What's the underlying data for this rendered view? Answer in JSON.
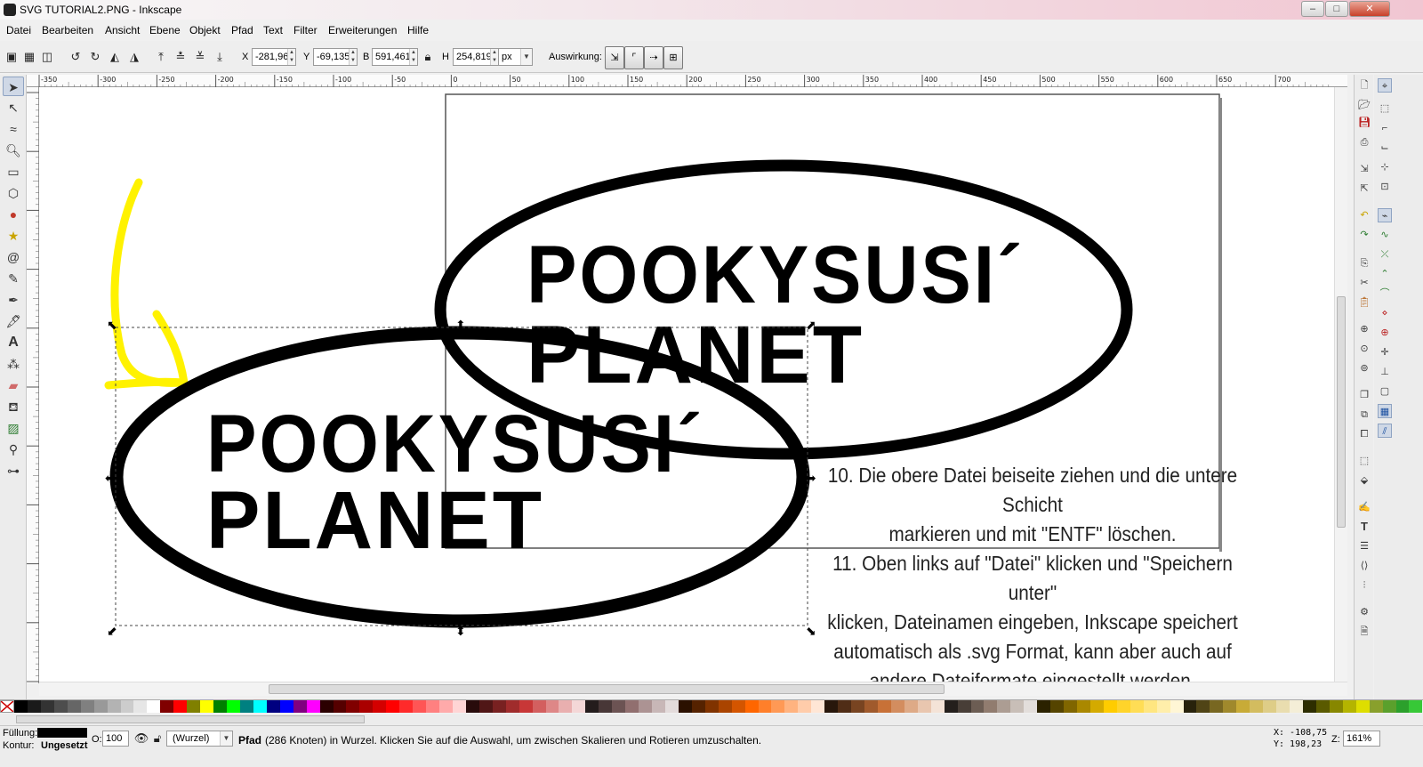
{
  "window": {
    "title": "SVG TUTORIAL2.PNG - Inkscape",
    "minimize_label": "–",
    "maximize_label": "□",
    "close_label": "✕"
  },
  "menu": [
    "Datei",
    "Bearbeiten",
    "Ansicht",
    "Ebene",
    "Objekt",
    "Pfad",
    "Text",
    "Filter",
    "Erweiterungen",
    "Hilfe"
  ],
  "toolbar": {
    "x_label": "X",
    "x_value": "-281,964",
    "y_label": "Y",
    "y_value": "-69,135",
    "w_label": "B",
    "w_value": "591,461",
    "h_label": "H",
    "h_value": "254,819",
    "unit": "px",
    "affect_label": "Auswirkung:"
  },
  "ruler": {
    "labels": [
      "-350",
      "-300",
      "-250",
      "-200",
      "-150",
      "-100",
      "-50",
      "0",
      "50",
      "100",
      "150",
      "200",
      "250",
      "300",
      "350",
      "400",
      "450",
      "500",
      "550",
      "600",
      "650",
      "700"
    ]
  },
  "canvas": {
    "logo_text_line1": "POOKYSUSI´",
    "logo_text_line2": "PLANET",
    "instructions": [
      "10. Die obere Datei beiseite ziehen und die untere Schicht",
      "markieren und mit \"ENTF\" löschen.",
      "11. Oben links auf \"Datei\" klicken und \"Speichern unter\"",
      "klicken, Dateinamen eingeben, Inkscape speichert",
      "automatisch als .svg Format, kann aber auch auf",
      "andere Dateiformate eingestellt werden."
    ],
    "arrow_color": "#fff200"
  },
  "palette": [
    "#000000",
    "#1a1a1a",
    "#333333",
    "#4d4d4d",
    "#666666",
    "#808080",
    "#999999",
    "#b3b3b3",
    "#cccccc",
    "#e6e6e6",
    "#ffffff",
    "#800000",
    "#ff0000",
    "#808000",
    "#ffff00",
    "#008000",
    "#00ff00",
    "#008080",
    "#00ffff",
    "#000080",
    "#0000ff",
    "#800080",
    "#ff00ff",
    "#2b0000",
    "#550000",
    "#800000",
    "#aa0000",
    "#d40000",
    "#ff0000",
    "#ff2a2a",
    "#ff5555",
    "#ff8080",
    "#ffaaaa",
    "#ffd5d5",
    "#280b0b",
    "#501616",
    "#782121",
    "#a02c2c",
    "#c83737",
    "#d35f5f",
    "#de8787",
    "#e9afaf",
    "#f4d7d7",
    "#241c1c",
    "#483737",
    "#6c5353",
    "#916f6f",
    "#ac9393",
    "#c8b7b7",
    "#e3dbdb",
    "#2b1100",
    "#552200",
    "#803300",
    "#aa4400",
    "#d45500",
    "#ff6600",
    "#ff7f2a",
    "#ff9955",
    "#ffb380",
    "#ffccaa",
    "#ffe6d5",
    "#28170b",
    "#502d16",
    "#784421",
    "#a05a2c",
    "#c87137",
    "#d38d5f",
    "#deaa87",
    "#e9c6af",
    "#f4e3d7",
    "#241f1c",
    "#483e37",
    "#6c5d53",
    "#917c6f",
    "#ac9d93",
    "#c8beb7",
    "#e3dedb",
    "#2b2200",
    "#554400",
    "#806600",
    "#aa8800",
    "#d4aa00",
    "#ffcc00",
    "#ffd42a",
    "#ffdd55",
    "#ffe680",
    "#ffeeaa",
    "#fff6d5",
    "#28220b",
    "#504416",
    "#786721",
    "#a0892c",
    "#c8ab37",
    "#d3bc5f",
    "#decd87",
    "#e9ddaf",
    "#f4eed7",
    "#2d2d00",
    "#5a5a00",
    "#878700",
    "#b4b400",
    "#dede00",
    "#89a02c",
    "#5aa02c",
    "#2ca02c",
    "#37c837"
  ],
  "status": {
    "fill_label": "Füllung:",
    "stroke_label": "Kontur:",
    "stroke_value": "Ungesetzt",
    "opacity_label": "O:",
    "opacity_value": "100",
    "layer": "(Wurzel)",
    "message_bold": "Pfad",
    "message": " (286 Knoten) in Wurzel. Klicken Sie auf die Auswahl, um zwischen Skalieren und Rotieren umzuschalten.",
    "x_readout": "X: -108,75",
    "y_readout": "Y: 198,23",
    "zoom_label": "Z:",
    "zoom_value": "161%"
  }
}
